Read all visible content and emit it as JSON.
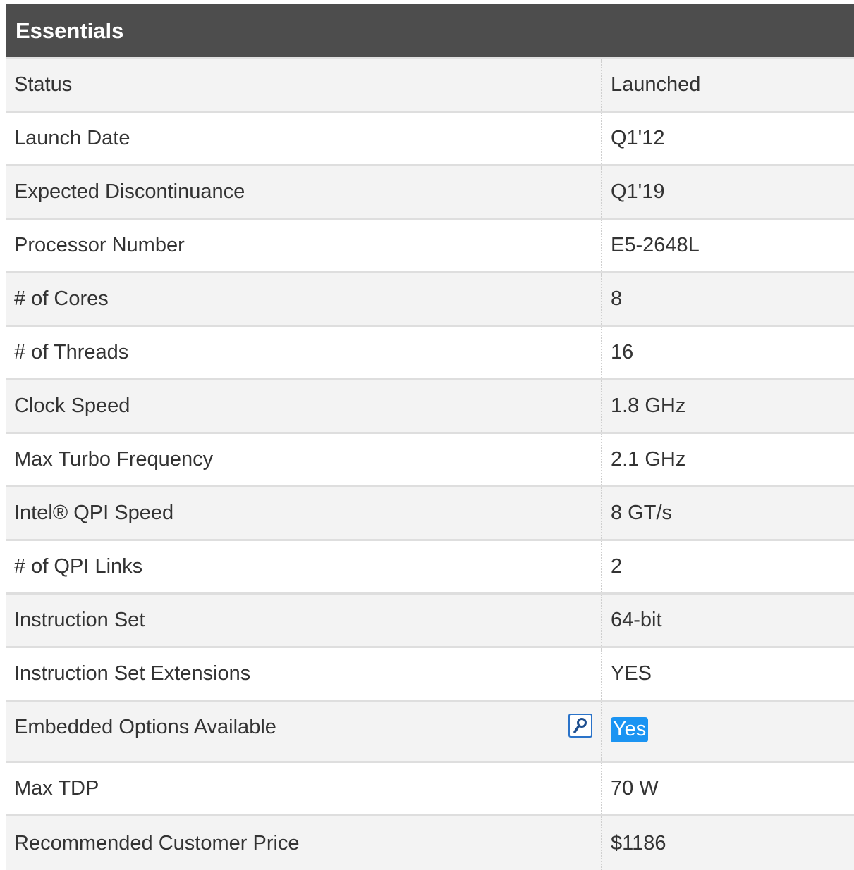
{
  "section": {
    "title": "Essentials"
  },
  "rows": [
    {
      "label": "Status",
      "value": "Launched"
    },
    {
      "label": "Launch Date",
      "value": "Q1'12"
    },
    {
      "label": "Expected Discontinuance",
      "value": "Q1'19"
    },
    {
      "label": "Processor Number",
      "value": "E5-2648L"
    },
    {
      "label": "# of Cores",
      "value": "8"
    },
    {
      "label": "# of Threads",
      "value": "16"
    },
    {
      "label": "Clock Speed",
      "value": "1.8 GHz"
    },
    {
      "label": "Max Turbo Frequency",
      "value": "2.1 GHz"
    },
    {
      "label": "Intel® QPI Speed",
      "value": "8 GT/s"
    },
    {
      "label": "# of QPI Links",
      "value": "2"
    },
    {
      "label": "Instruction Set",
      "value": "64-bit"
    },
    {
      "label": "Instruction Set Extensions",
      "value": "YES"
    },
    {
      "label": "Embedded Options Available",
      "value": "Yes",
      "icon": "search-icon"
    },
    {
      "label": "Max TDP",
      "value": "70 W"
    },
    {
      "label": "Recommended Customer Price",
      "value": "$1186"
    }
  ],
  "colors": {
    "header_bg": "#4d4d4d",
    "badge_bg": "#1b94f2",
    "icon_border": "#2a73c9"
  }
}
